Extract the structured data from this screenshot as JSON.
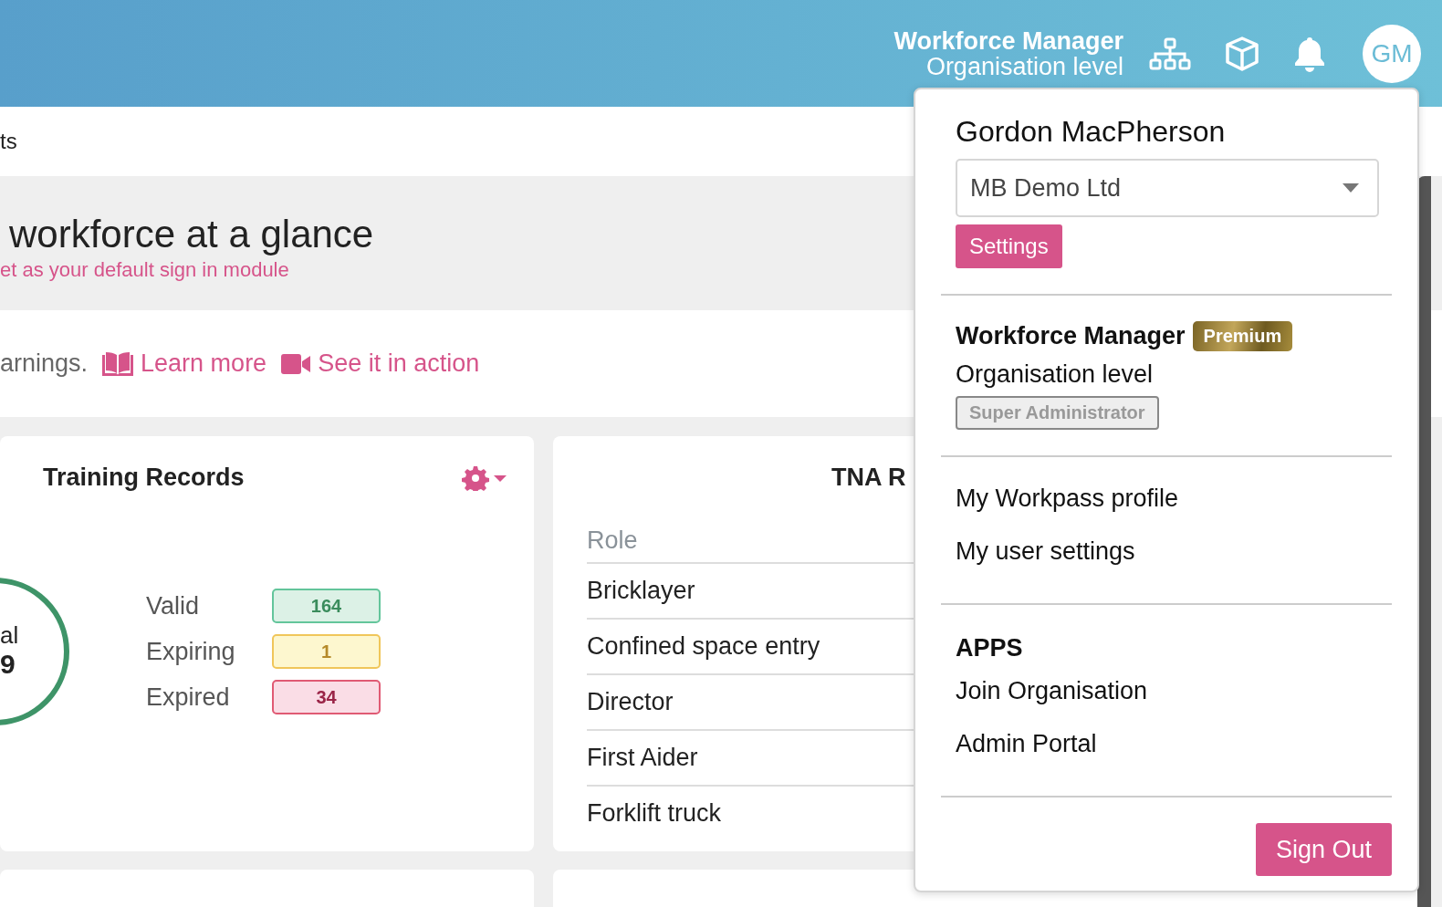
{
  "header": {
    "title": "Workforce Manager",
    "subtitle": "Organisation level",
    "avatar_initials": "GM"
  },
  "page": {
    "breadcrumb": "ts",
    "heading": "workforce at a glance",
    "default_link": "et as your default sign in module",
    "intro_text": "arnings.",
    "links": [
      {
        "label": "Learn more",
        "kind": "book"
      },
      {
        "label": "See it in action",
        "kind": "video"
      }
    ]
  },
  "training_card": {
    "title": "Training Records",
    "total_label": "al",
    "total_value": "9",
    "statuses": [
      {
        "label": "Valid",
        "count": "164",
        "kind": "valid"
      },
      {
        "label": "Expiring",
        "count": "1",
        "kind": "expiring"
      },
      {
        "label": "Expired",
        "count": "34",
        "kind": "expired"
      }
    ]
  },
  "tna_card": {
    "title": "TNA R",
    "column": "Role",
    "rows": [
      "Bricklayer",
      "Confined space entry",
      "Director",
      "First Aider",
      "Forklift truck"
    ]
  },
  "user_menu": {
    "name": "Gordon MacPherson",
    "organisation": "MB Demo Ltd",
    "settings_button": "Settings",
    "product": "Workforce Manager",
    "plan_badge": "Premium",
    "level": "Organisation level",
    "role_badge": "Super Administrator",
    "links": [
      "My Workpass profile",
      "My user settings"
    ],
    "apps_heading": "APPS",
    "apps": [
      "Join Organisation",
      "Admin Portal"
    ],
    "sign_out": "Sign Out"
  }
}
